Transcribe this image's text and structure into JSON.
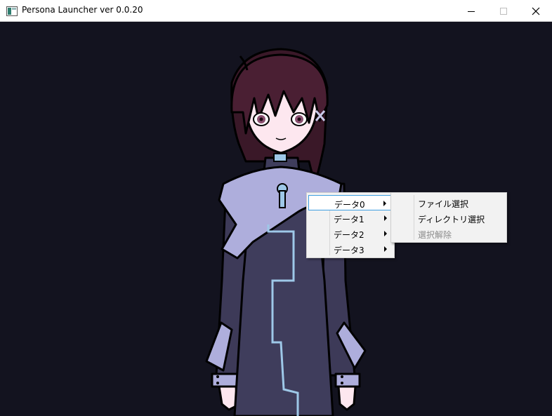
{
  "window": {
    "title": "Persona Launcher ver 0.0.20",
    "controls": {
      "minimize": "minimize-icon",
      "maximize": "maximize-icon",
      "close": "close-icon"
    }
  },
  "context_menu": {
    "items": [
      {
        "label": "データ0",
        "has_submenu": true,
        "highlighted": true
      },
      {
        "label": "データ1",
        "has_submenu": true,
        "highlighted": false
      },
      {
        "label": "データ2",
        "has_submenu": true,
        "highlighted": false
      },
      {
        "label": "データ3",
        "has_submenu": true,
        "highlighted": false
      }
    ]
  },
  "submenu": {
    "items": [
      {
        "label": "ファイル選択",
        "enabled": true
      },
      {
        "label": "ディレクトリ選択",
        "enabled": true
      },
      {
        "label": "選択解除",
        "enabled": false
      }
    ]
  },
  "colors": {
    "background": "#13131f",
    "menu_background": "#f2f2f2",
    "menu_highlight_border": "#3c9ee0",
    "disabled_text": "#8c8c8c"
  }
}
